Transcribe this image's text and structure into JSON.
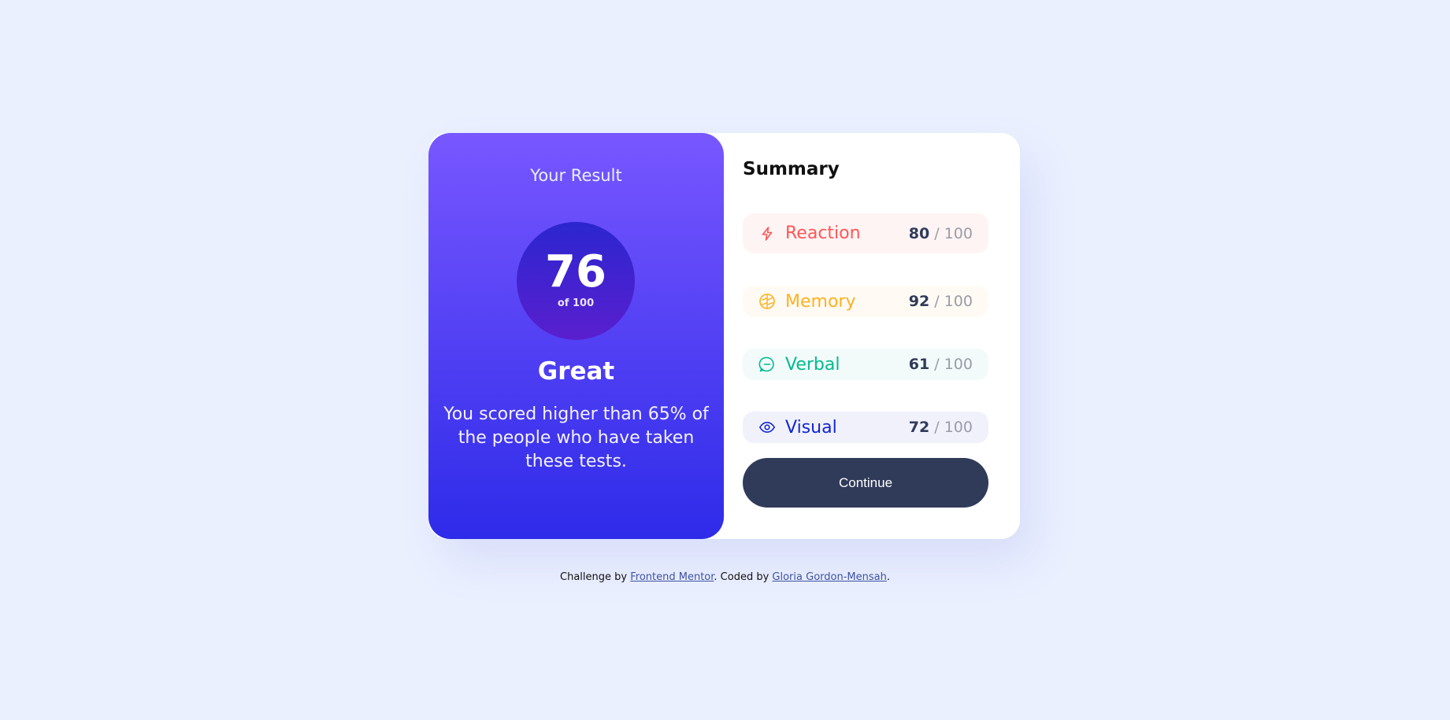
{
  "result": {
    "title": "Your Result",
    "score": "76",
    "of_text": "of 100",
    "rating": "Great",
    "description": "You scored higher than 65% of the people who have taken these tests."
  },
  "summary": {
    "title": "Summary",
    "items": [
      {
        "label": "Reaction",
        "score": "80",
        "total": "/ 100",
        "icon": "lightning-icon",
        "color": "#ff5757"
      },
      {
        "label": "Memory",
        "score": "92",
        "total": "/ 100",
        "icon": "brain-icon",
        "color": "#ffb01f"
      },
      {
        "label": "Verbal",
        "score": "61",
        "total": "/ 100",
        "icon": "chat-bubble-icon",
        "color": "#00bb8f"
      },
      {
        "label": "Visual",
        "score": "72",
        "total": "/ 100",
        "icon": "eye-icon",
        "color": "#1125d4"
      }
    ],
    "continue_label": "Continue"
  },
  "footer": {
    "prefix": "Challenge by ",
    "link1": "Frontend Mentor",
    "middle": ". Coded by ",
    "link2": "Gloria Gordon-Mensah",
    "suffix": "."
  },
  "colors": {
    "background": "#ebf0ff",
    "gradient_top": "#7857ff",
    "gradient_bottom": "#2e2be9",
    "button": "#303b5a"
  }
}
